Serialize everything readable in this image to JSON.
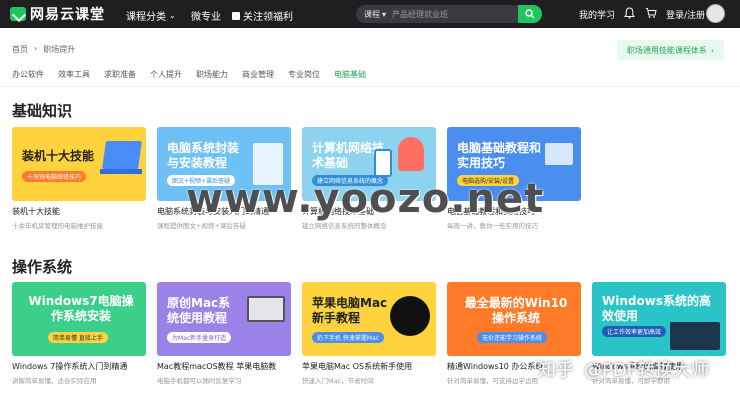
{
  "header": {
    "logo_text": "网易云课堂",
    "nav": [
      {
        "label": "课程分类",
        "has_dropdown": true
      },
      {
        "label": "微专业"
      },
      {
        "label": "关注领福利"
      }
    ],
    "search": {
      "scope": "课程",
      "placeholder": "产品经理就业班"
    },
    "my_learning": "我的学习",
    "login": "登录/注册"
  },
  "breadcrumb": [
    "首页",
    "职场提升"
  ],
  "promo_link": "职场通用技能课程体系",
  "tabs": [
    "办公软件",
    "效率工具",
    "求职准备",
    "个人提升",
    "职场能力",
    "商业管理",
    "专业岗位",
    "电脑基础"
  ],
  "active_tab": "电脑基础",
  "sections": [
    {
      "title": "基础知识",
      "cards": [
        {
          "thumb_title": "装机十大技能",
          "thumb_tag": "十块钱电脑维修技巧",
          "caption": "装机十大技能",
          "subcaption": "十余年机房管理的电脑维护技能"
        },
        {
          "thumb_title": "电脑系统封装与安装教程",
          "thumb_tag": "图文+视频+课后答疑",
          "caption": "电脑系统封装与安装入门到精通",
          "subcaption": "课程提供图文+视频+课后答疑"
        },
        {
          "thumb_title": "计算机网络技术基础",
          "thumb_tag": "建立网络信息系统的概念",
          "caption": "计算机网络技术基础",
          "subcaption": "建立网络信息系统的整体概念"
        },
        {
          "thumb_title": "电脑基础教程和实用技巧",
          "thumb_tag": "电脑选购/安装/设置",
          "caption": "电脑基础教程和实用技巧",
          "subcaption": "每周一讲，教你一些实用的技巧"
        }
      ]
    },
    {
      "title": "操作系统",
      "cards": [
        {
          "thumb_title": "Windows7电脑操作系统安装",
          "thumb_tag": "简单易懂 直接上手",
          "caption": "Windows 7操作系统入门到精通",
          "subcaption": "讲解简单易懂，适合实际应用"
        },
        {
          "thumb_title": "原创Mac系统使用教程",
          "thumb_tag": "为Mac新手量身打造",
          "caption": "Mac教程macOS教程 苹果电脑教",
          "subcaption": "电脑手机都可以随时反复学习"
        },
        {
          "thumb_title": "苹果电脑Mac新手教程",
          "thumb_tag": "扔下手机 快速掌握Mac",
          "caption": "苹果电脑Mac OS系统新手使用",
          "subcaption": "快速入门Mac，节省时间"
        },
        {
          "thumb_title": "最全最新的Win10操作系统",
          "thumb_tag": "无价还能学习操作系统",
          "caption": "精通Windows10 办公系统",
          "subcaption": "针对简单易懂，可支持边学边用"
        },
        {
          "thumb_title": "Windows系统的高效使用",
          "thumb_tag": "让工作效率更加高效",
          "caption": "Windows系统的高效使用",
          "subcaption": "针对简单易懂，可即学即用"
        }
      ]
    }
  ],
  "watermark": "www.yoozo.net",
  "watermark_brand": [
    "知乎",
    "@PDF转换大师"
  ],
  "colors": {
    "brand_green": "#21c55e",
    "topbar": "#1f1f22",
    "active_tab": "#21a85a"
  }
}
